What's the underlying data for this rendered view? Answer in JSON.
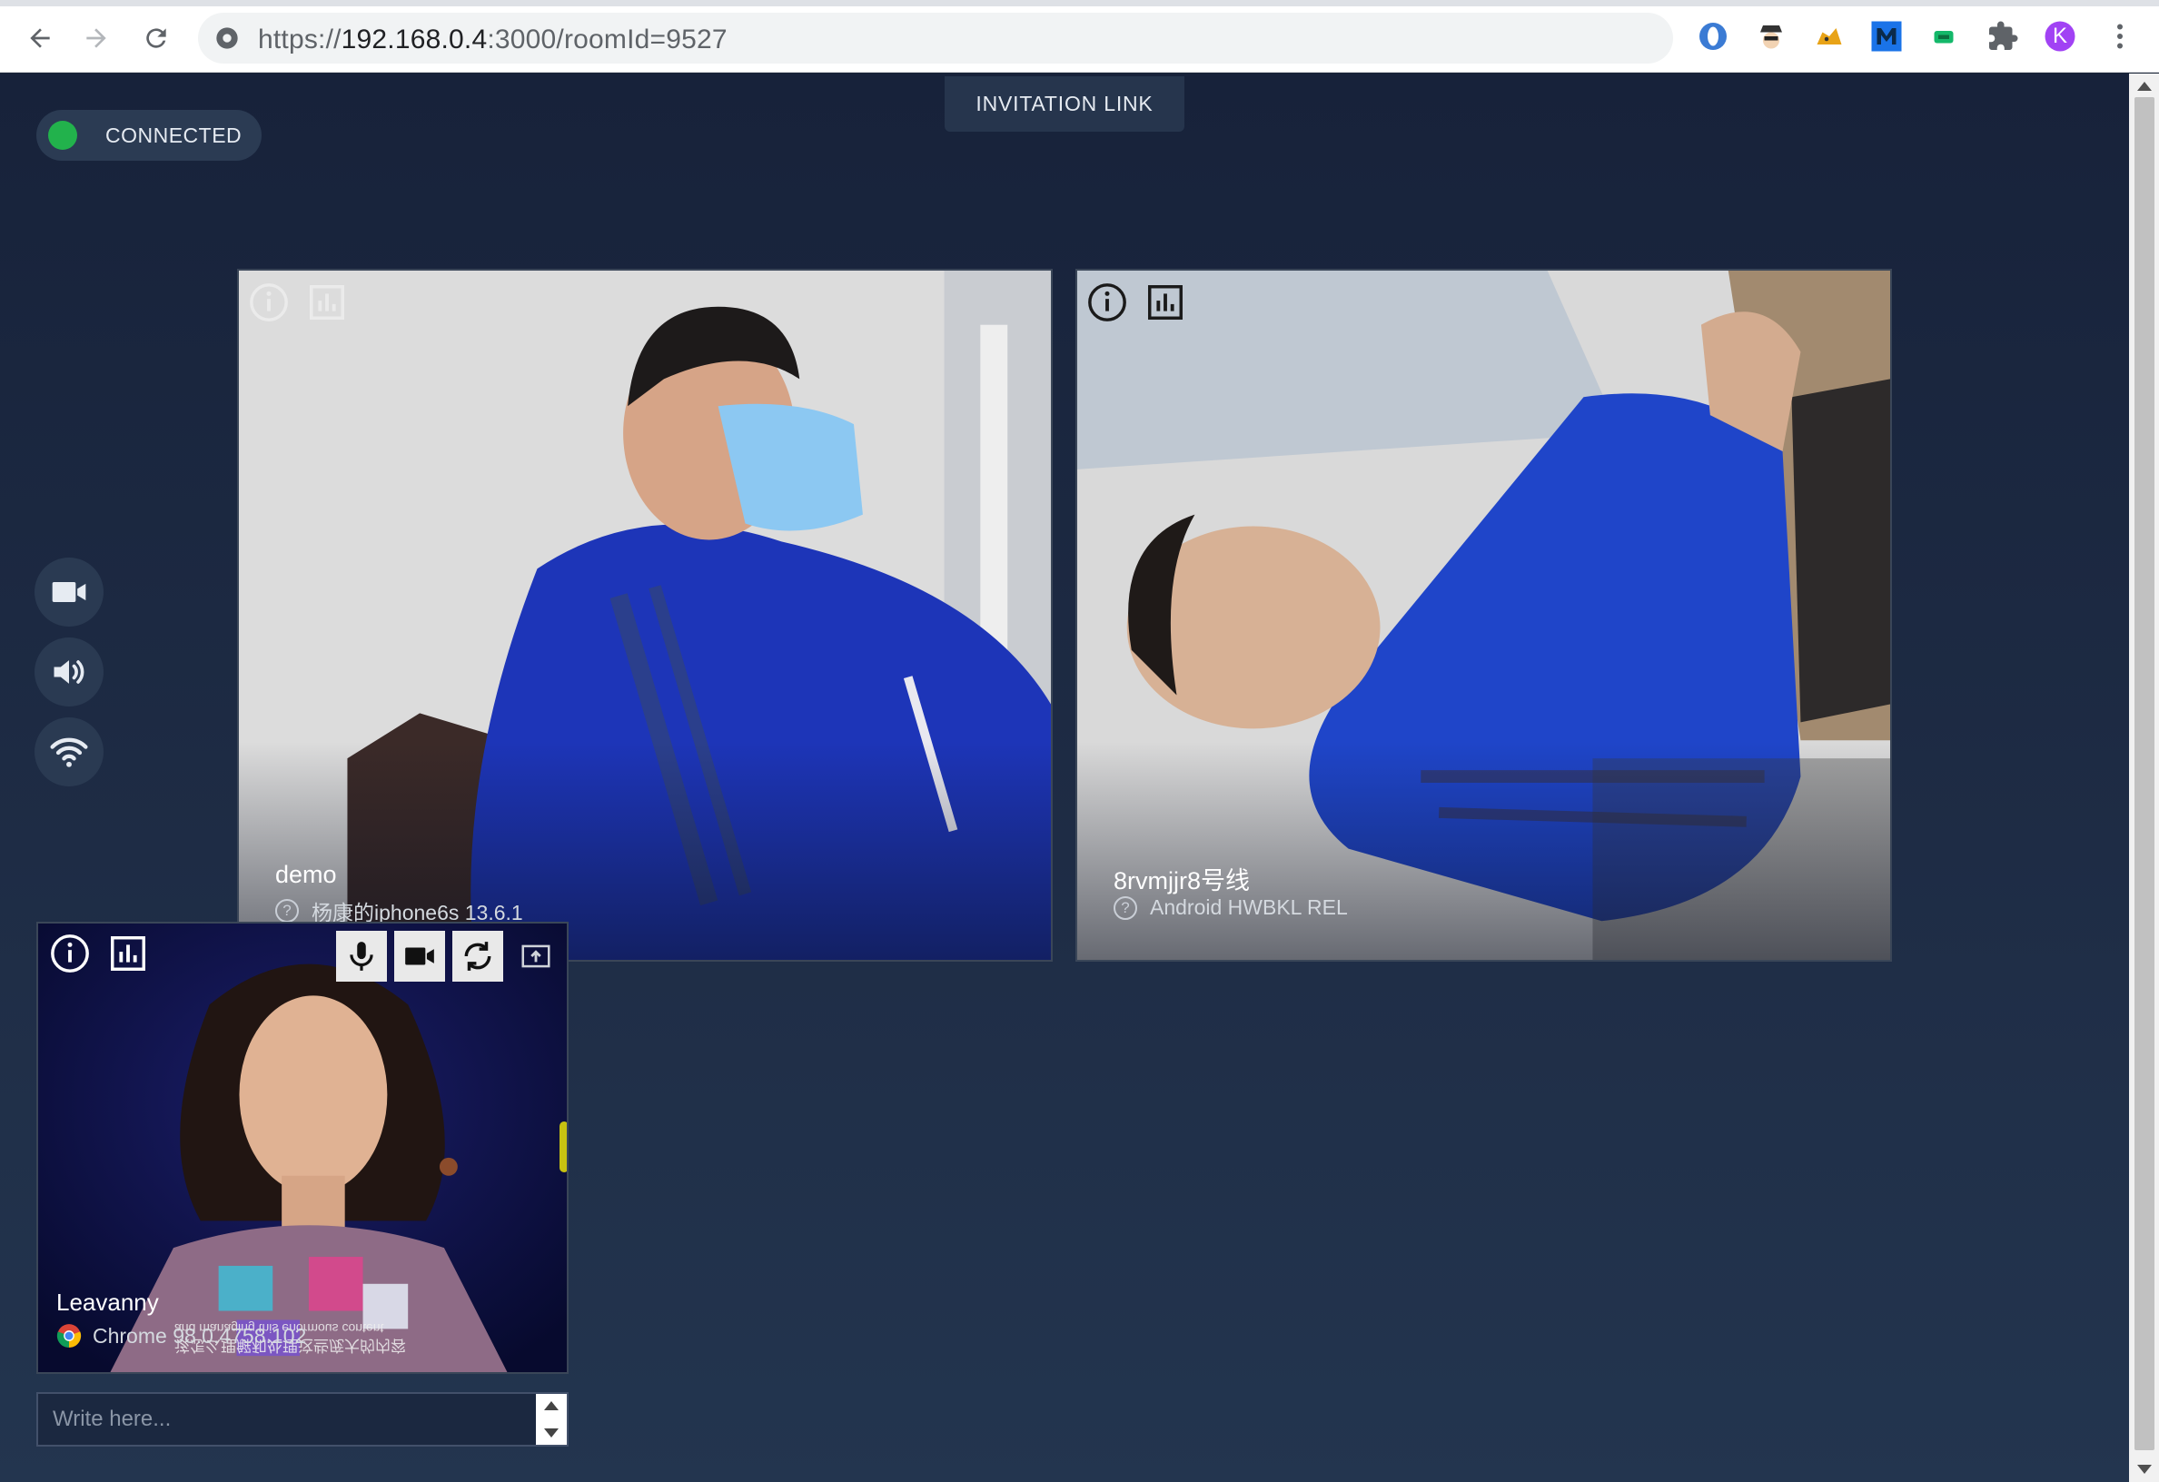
{
  "browser": {
    "url_scheme": "https://",
    "url_host": "192.168.0.4",
    "url_rest": ":3000/roomId=9527",
    "profile_initial": "K",
    "profile_color": "#a142f4"
  },
  "status": {
    "label": "CONNECTED",
    "color": "#22b24c"
  },
  "invite": {
    "label": "INVITATION LINK"
  },
  "sidebar": {
    "items": [
      {
        "icon": "video-camera-icon"
      },
      {
        "icon": "speaker-icon"
      },
      {
        "icon": "wifi-icon"
      }
    ]
  },
  "peers": [
    {
      "name": "demo",
      "device": "杨康的iphone6s 13.6.1"
    },
    {
      "name": "8rvmjjr8号线",
      "device": "Android HWBKL REL"
    }
  ],
  "local": {
    "name": "Leavanny",
    "device": "Chrome 98.0.4758.102",
    "subtitle_cn": "该怎么理解和处理这些庞大的内容",
    "subtitle_en": "and managing this enormous content"
  },
  "chat": {
    "placeholder": "Write here..."
  },
  "colors": {
    "page_bg": "#1a2538",
    "badge_bg": "#2b3b53",
    "accent_level": "#c8c211"
  }
}
